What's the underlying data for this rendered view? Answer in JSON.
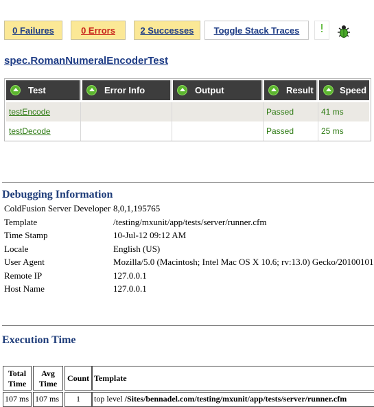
{
  "toolbar": {
    "failures_label": "0 Failures",
    "errors_label": "0 Errors",
    "successes_label": "2 Successes",
    "toggle_label": "Toggle Stack Traces",
    "bug_icon": "bug-icon",
    "colors": {
      "button_bg": "#fbe896",
      "errors_text": "#c8251c",
      "link_text": "#1f3d86"
    }
  },
  "spec": {
    "title": "spec.RomanNumeralEncoderTest"
  },
  "results": {
    "headers": [
      "Test",
      "Error Info",
      "Output",
      "Result",
      "Speed"
    ],
    "header_icon": "sort-arrow-icon",
    "rows": [
      {
        "test": "testEncode",
        "error_info": "",
        "output": "",
        "result": "Passed",
        "speed": "41 ms"
      },
      {
        "test": "testDecode",
        "error_info": "",
        "output": "",
        "result": "Passed",
        "speed": "25 ms"
      }
    ],
    "colors": {
      "header_bg": "#3d3d3d",
      "passed_text": "#2d7a12",
      "icon": "#5cb52f"
    }
  },
  "debug": {
    "title": "Debugging Information",
    "rows": [
      {
        "key": "ColdFusion Server Developer",
        "value": "8,0,1,195765"
      },
      {
        "key": "Template",
        "value": "/testing/mxunit/app/tests/server/runner.cfm"
      },
      {
        "key": "Time Stamp",
        "value": "10-Jul-12 09:12 AM"
      },
      {
        "key": "Locale",
        "value": "English (US)"
      },
      {
        "key": "User Agent",
        "value": "Mozilla/5.0 (Macintosh; Intel Mac OS X 10.6; rv:13.0) Gecko/20100101"
      },
      {
        "key": "Remote IP",
        "value": "127.0.0.1"
      },
      {
        "key": "Host Name",
        "value": "127.0.0.1"
      }
    ]
  },
  "execution": {
    "title": "Execution Time",
    "headers": {
      "total_line1": "Total",
      "total_line2": "Time",
      "avg_line1": "Avg",
      "avg_line2": "Time",
      "count": "Count",
      "template": "Template"
    },
    "row": {
      "total": "107 ms",
      "avg": "107 ms",
      "count": "1",
      "template_prefix": "top level ",
      "template_path": "/Sites/bennadel.com/testing/mxunit/app/tests/server/runner.cfm"
    }
  }
}
